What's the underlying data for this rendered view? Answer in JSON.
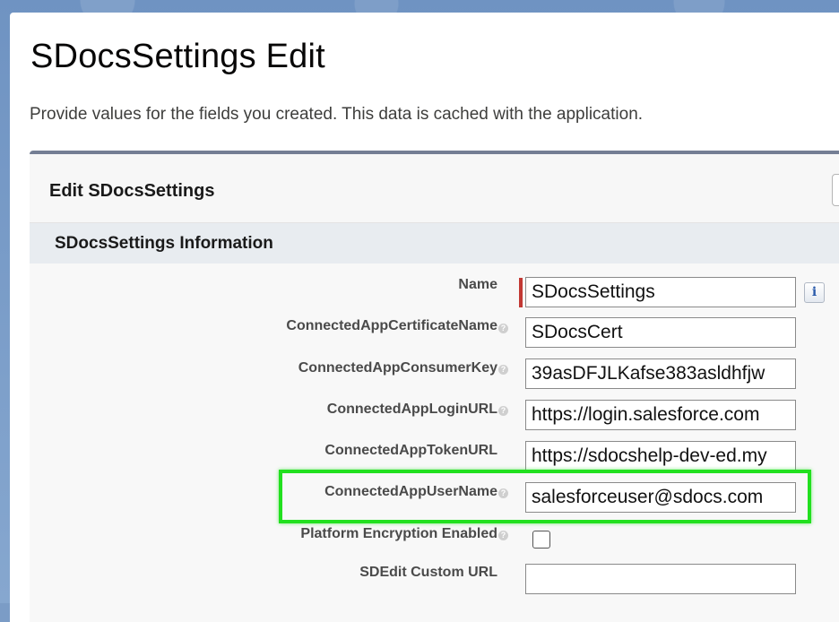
{
  "page": {
    "title": "SDocsSettings Edit",
    "description": "Provide values for the fields you created. This data is cached with the application."
  },
  "panel": {
    "title": "Edit SDocsSettings",
    "section_title": "SDocsSettings Information"
  },
  "fields": [
    {
      "label": "Name",
      "value": "SDocsSettings",
      "required": true,
      "help": false
    },
    {
      "label": "ConnectedAppCertificateName",
      "value": "SDocsCert",
      "help": true
    },
    {
      "label": "ConnectedAppConsumerKey",
      "value": "39asDFJLKafse383asldhfjw",
      "help": true
    },
    {
      "label": "ConnectedAppLoginURL",
      "value": "https://login.salesforce.com",
      "help": true
    },
    {
      "label": "ConnectedAppTokenURL",
      "value": "https://sdocshelp-dev-ed.my",
      "help": false
    },
    {
      "label": "ConnectedAppUserName",
      "value": "salesforceuser@sdocs.com",
      "help": true,
      "highlighted": true
    },
    {
      "label": "Platform Encryption Enabled",
      "checked": false,
      "help": true
    },
    {
      "label": "SDEdit Custom URL",
      "value": "",
      "help": false
    }
  ],
  "icons": {
    "help": "?",
    "info": "i"
  },
  "colors": {
    "required": "#c23934",
    "highlight": "#22e01f",
    "panel_border": "#747e94"
  }
}
